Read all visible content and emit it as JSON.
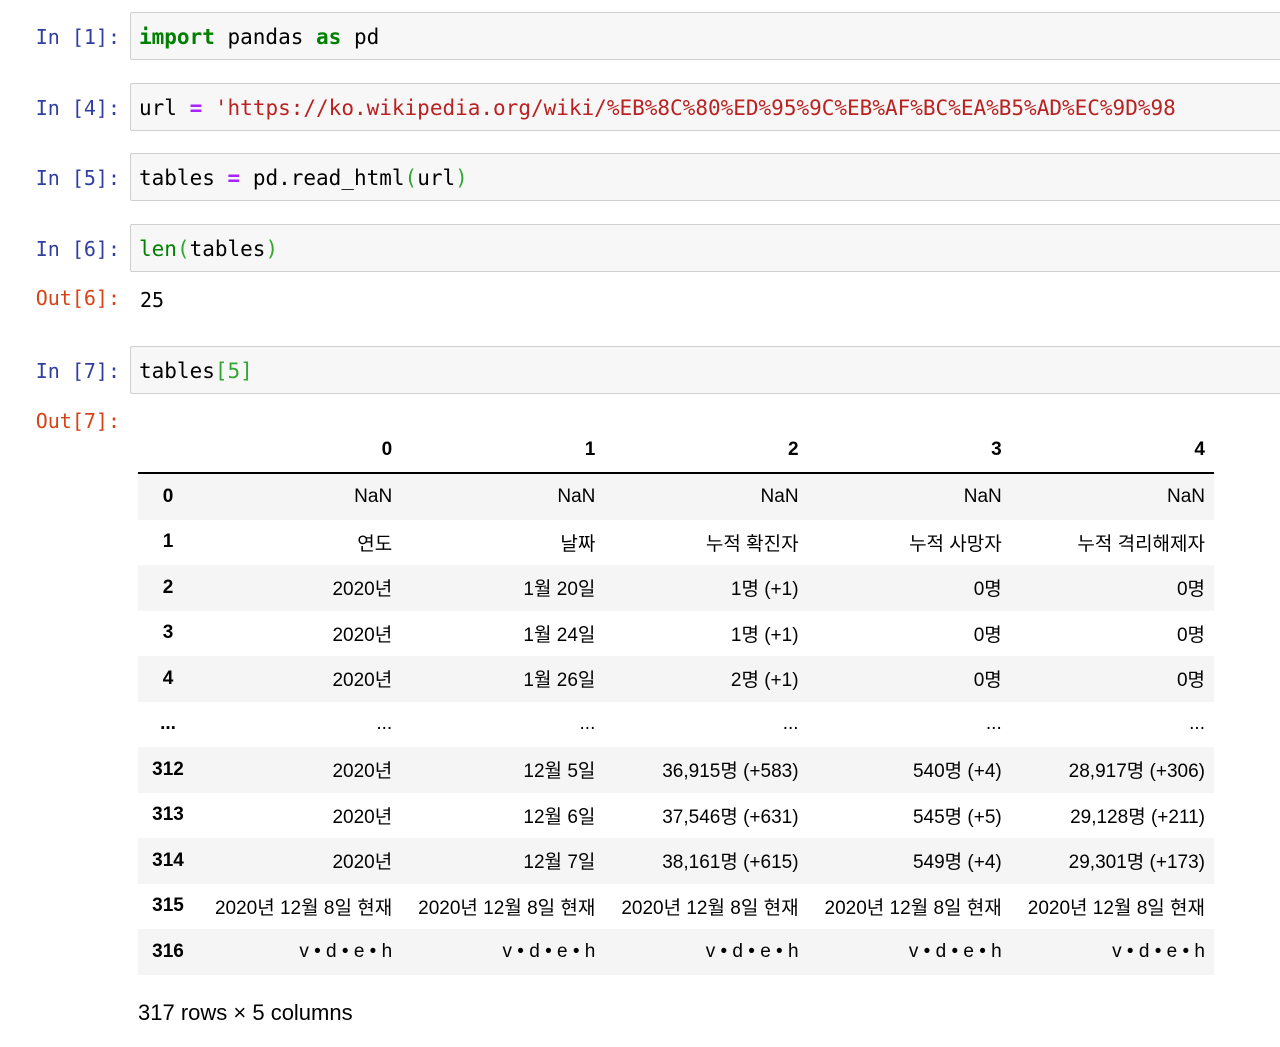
{
  "cells": [
    {
      "prompt": "In [1]:",
      "tokens": [
        [
          "kw",
          "import"
        ],
        [
          "plain",
          " pandas "
        ],
        [
          "kw",
          "as"
        ],
        [
          "plain",
          " pd"
        ]
      ]
    },
    {
      "prompt": "In [4]:",
      "tokens": [
        [
          "plain",
          "url "
        ],
        [
          "op",
          "="
        ],
        [
          "plain",
          " "
        ],
        [
          "str",
          "'https://ko.wikipedia.org/wiki/%EB%8C%80%ED%95%9C%EB%AF%BC%EA%B5%AD%EC%9D%98"
        ]
      ]
    },
    {
      "prompt": "In [5]:",
      "tokens": [
        [
          "plain",
          "tables "
        ],
        [
          "op",
          "="
        ],
        [
          "plain",
          " pd.read_html"
        ],
        [
          "par",
          "("
        ],
        [
          "plain",
          "url"
        ],
        [
          "par",
          ")"
        ]
      ]
    },
    {
      "prompt": "In [6]:",
      "tokens": [
        [
          "fn",
          "len"
        ],
        [
          "par",
          "("
        ],
        [
          "plain",
          "tables"
        ],
        [
          "par",
          ")"
        ]
      ]
    },
    {
      "prompt": "In [7]:",
      "tokens": [
        [
          "plain",
          "tables"
        ],
        [
          "par",
          "[5]"
        ]
      ]
    }
  ],
  "outputs": {
    "out6": {
      "prompt": "Out[6]:",
      "text": "25"
    },
    "out7": {
      "prompt": "Out[7]:"
    }
  },
  "dataframe": {
    "columns": [
      "0",
      "1",
      "2",
      "3",
      "4"
    ],
    "rows": [
      {
        "index": "0",
        "cells": [
          "NaN",
          "NaN",
          "NaN",
          "NaN",
          "NaN"
        ]
      },
      {
        "index": "1",
        "cells": [
          "연도",
          "날짜",
          "누적 확진자",
          "누적 사망자",
          "누적 격리해제자"
        ]
      },
      {
        "index": "2",
        "cells": [
          "2020년",
          "1월 20일",
          "1명 (+1)",
          "0명",
          "0명"
        ]
      },
      {
        "index": "3",
        "cells": [
          "2020년",
          "1월 24일",
          "1명 (+1)",
          "0명",
          "0명"
        ]
      },
      {
        "index": "4",
        "cells": [
          "2020년",
          "1월 26일",
          "2명 (+1)",
          "0명",
          "0명"
        ]
      },
      {
        "index": "...",
        "cells": [
          "...",
          "...",
          "...",
          "...",
          "..."
        ]
      },
      {
        "index": "312",
        "cells": [
          "2020년",
          "12월 5일",
          "36,915명 (+583)",
          "540명 (+4)",
          "28,917명 (+306)"
        ]
      },
      {
        "index": "313",
        "cells": [
          "2020년",
          "12월 6일",
          "37,546명 (+631)",
          "545명 (+5)",
          "29,128명 (+211)"
        ]
      },
      {
        "index": "314",
        "cells": [
          "2020년",
          "12월 7일",
          "38,161명 (+615)",
          "549명 (+4)",
          "29,301명 (+173)"
        ]
      },
      {
        "index": "315",
        "cells": [
          "2020년 12월 8일 현재",
          "2020년 12월 8일 현재",
          "2020년 12월 8일 현재",
          "2020년 12월 8일 현재",
          "2020년 12월 8일 현재"
        ]
      },
      {
        "index": "316",
        "cells": [
          "v • d • e • h",
          "v • d • e • h",
          "v • d • e • h",
          "v • d • e • h",
          "v • d • e • h"
        ]
      }
    ],
    "shape_text": "317 rows × 5 columns"
  }
}
